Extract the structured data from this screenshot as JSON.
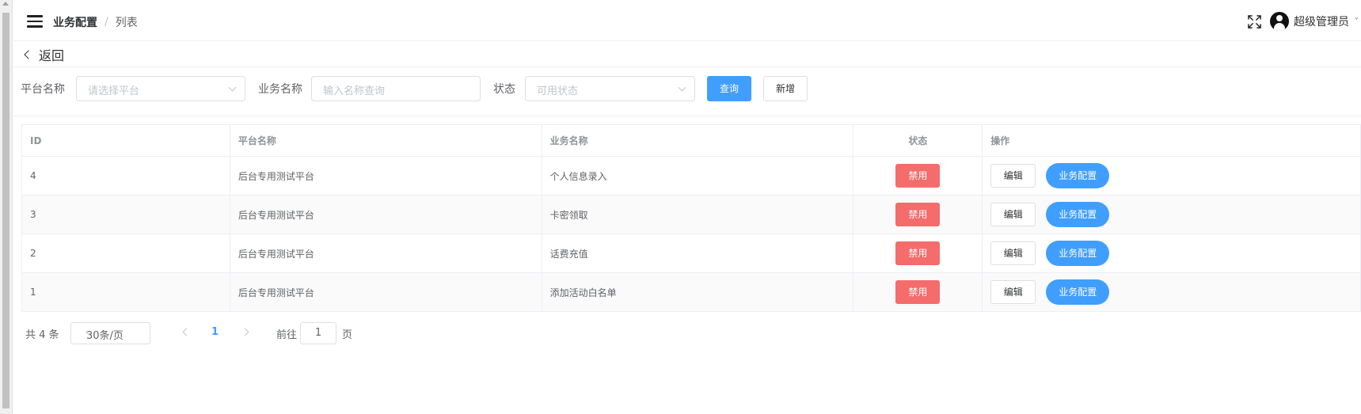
{
  "header": {
    "breadcrumb": [
      "业务配置",
      "列表"
    ],
    "user_name": "超级管理员"
  },
  "back_label": "返回",
  "filter": {
    "platform_label": "平台名称",
    "platform_placeholder": "请选择平台",
    "business_label": "业务名称",
    "business_placeholder": "输入名称查询",
    "status_label": "状态",
    "status_placeholder": "可用状态",
    "query_label": "查询",
    "add_label": "新增"
  },
  "table": {
    "columns": [
      "ID",
      "平台名称",
      "业务名称",
      "状态",
      "操作"
    ],
    "rows": [
      {
        "id": "4",
        "platform": "后台专用测试平台",
        "business": "个人信息录入",
        "status": "禁用",
        "edit": "编辑",
        "config": "业务配置"
      },
      {
        "id": "3",
        "platform": "后台专用测试平台",
        "business": "卡密领取",
        "status": "禁用",
        "edit": "编辑",
        "config": "业务配置"
      },
      {
        "id": "2",
        "platform": "后台专用测试平台",
        "business": "话费充值",
        "status": "禁用",
        "edit": "编辑",
        "config": "业务配置"
      },
      {
        "id": "1",
        "platform": "后台专用测试平台",
        "business": "添加活动白名单",
        "status": "禁用",
        "edit": "编辑",
        "config": "业务配置"
      }
    ]
  },
  "pagination": {
    "total": "共 4 条",
    "page_size": "30条/页",
    "current_page": "1",
    "goto_label": "前往",
    "goto_value": "1",
    "page_word": "页"
  },
  "colors": {
    "primary": "#409eff",
    "danger": "#f56c6c"
  }
}
